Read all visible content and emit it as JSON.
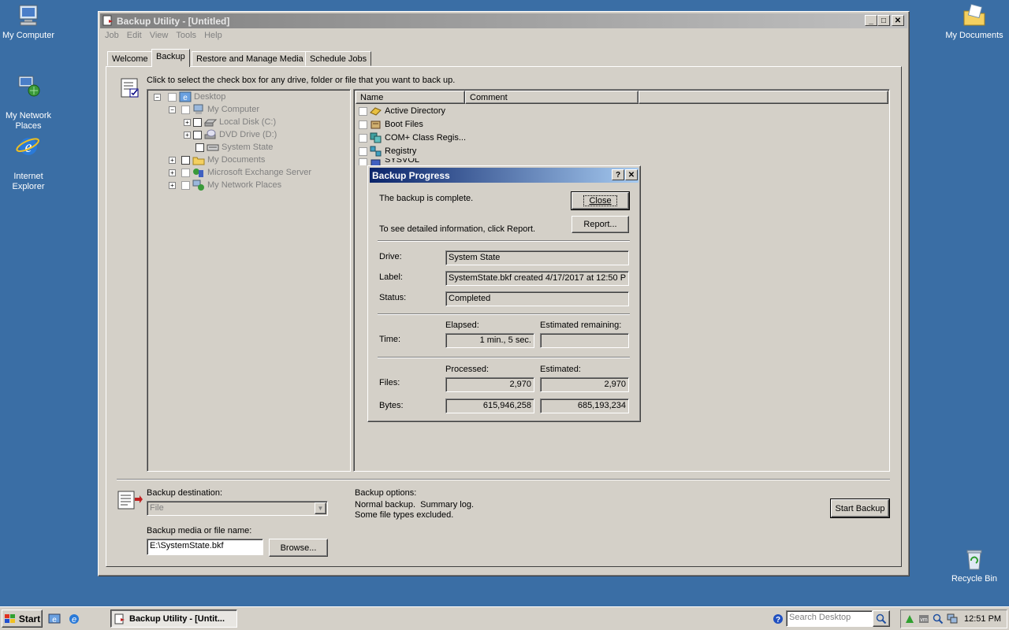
{
  "desktop": {
    "icons": [
      {
        "label": "My Computer",
        "icon": "my-computer-icon"
      },
      {
        "label": "My Network\nPlaces",
        "icon": "network-places-icon"
      },
      {
        "label": "Internet\nExplorer",
        "icon": "internet-explorer-icon"
      },
      {
        "label": "My Documents",
        "icon": "my-documents-icon"
      },
      {
        "label": "Recycle Bin",
        "icon": "recycle-bin-icon"
      }
    ]
  },
  "window": {
    "title": "Backup Utility - [Untitled]",
    "menu": [
      "Job",
      "Edit",
      "View",
      "Tools",
      "Help"
    ],
    "tabs": [
      "Welcome",
      "Backup",
      "Restore and Manage Media",
      "Schedule Jobs"
    ],
    "active_tab": "Backup",
    "instruction": "Click to select the check box for any drive, folder or file that you want to back up.",
    "tree": [
      {
        "label": "Desktop",
        "indent": 0,
        "expander": "minus",
        "disabled": true
      },
      {
        "label": "My Computer",
        "indent": 1,
        "expander": "minus",
        "disabled": true
      },
      {
        "label": "Local Disk (C:)",
        "indent": 2,
        "expander": "plus",
        "disabled": true
      },
      {
        "label": "DVD Drive (D:)",
        "indent": 2,
        "expander": "plus",
        "disabled": true
      },
      {
        "label": "System State",
        "indent": 2,
        "expander": "none",
        "disabled": true
      },
      {
        "label": "My Documents",
        "indent": 1,
        "expander": "plus",
        "disabled": true
      },
      {
        "label": "Microsoft Exchange Server",
        "indent": 1,
        "expander": "plus",
        "disabled": true
      },
      {
        "label": "My Network Places",
        "indent": 1,
        "expander": "plus",
        "disabled": true
      }
    ],
    "list_headers": [
      "Name",
      "Comment"
    ],
    "list_items": [
      "Active Directory",
      "Boot Files",
      "COM+ Class Regis...",
      "Registry",
      "SYSVOL"
    ],
    "backup_destination_label": "Backup destination:",
    "backup_destination_value": "File",
    "backup_media_label": "Backup media or file name:",
    "backup_media_value": "E:\\SystemState.bkf",
    "browse_label": "Browse...",
    "options_title": "Backup options:",
    "options_line1": "Normal backup.  Summary log.",
    "options_line2": "Some file types excluded.",
    "start_backup_label": "Start Backup"
  },
  "dialog": {
    "title": "Backup Progress",
    "message": "The backup is complete.",
    "report_hint": "To see detailed information, click Report.",
    "close_label": "Close",
    "report_label": "Report...",
    "drive_label": "Drive:",
    "drive_value": "System State",
    "label_label": "Label:",
    "label_value": "SystemState.bkf created 4/17/2017 at 12:50 P",
    "status_label": "Status:",
    "status_value": "Completed",
    "elapsed_header": "Elapsed:",
    "remaining_header": "Estimated remaining:",
    "time_label": "Time:",
    "elapsed_value": "1 min., 5 sec.",
    "remaining_value": "",
    "processed_header": "Processed:",
    "estimated_header": "Estimated:",
    "files_label": "Files:",
    "files_processed": "2,970",
    "files_estimated": "2,970",
    "bytes_label": "Bytes:",
    "bytes_processed": "615,946,258",
    "bytes_estimated": "685,193,234"
  },
  "taskbar": {
    "start_label": "Start",
    "task_label": "Backup Utility - [Untit...",
    "search_placeholder": "Search Desktop",
    "clock": "12:51 PM"
  },
  "colors": {
    "desktop": "#3a6ea5",
    "titlebar_inactive": "#808080",
    "titlebar_active": "#0a246a",
    "face": "#d4d0c8"
  }
}
